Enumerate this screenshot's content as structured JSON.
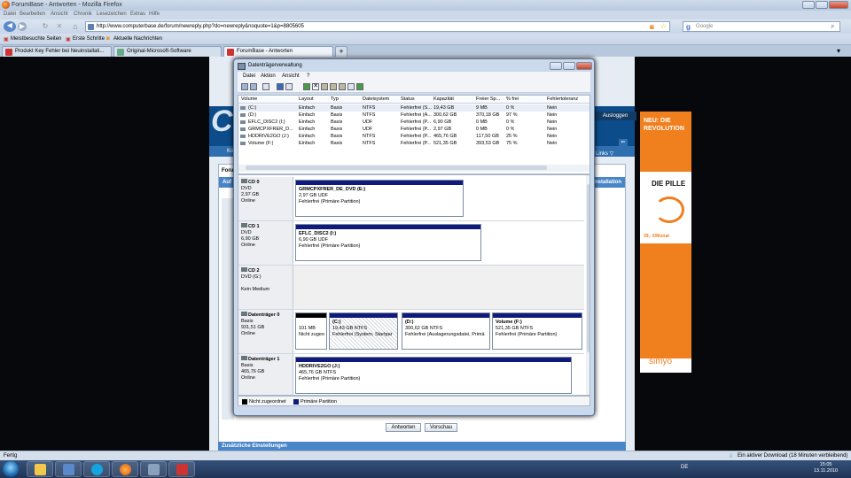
{
  "browser": {
    "title": "ForumBase - Antworten - Mozilla Firefox",
    "menu": [
      "Datei",
      "Bearbeiten",
      "Ansicht",
      "Chronik",
      "Lesezeichen",
      "Extras",
      "Hilfe"
    ],
    "url": "http://www.computerbase.de/forum/newreply.php?do=newreply&noquote=1&p=8805605",
    "search_placeholder": "Google",
    "bookmarks": [
      "Meistbesuchte Seiten",
      "Erste Schritte",
      "Aktuelle Nachrichten"
    ],
    "tabs": [
      "Produkt Key Fehler bei Neuinstallati...",
      "Original-Microsoft-Software",
      "ForumBase - Antworten"
    ],
    "status_left": "Fertig",
    "status_right": "Ein aktiver Download (18 Minuten verbleibend)"
  },
  "site": {
    "logo": "C",
    "ausloggen": "Ausloggen",
    "links": "Links ▽",
    "forum_label": "Foru",
    "panel_title": "Auf",
    "installation": "Installation",
    "ko": "Ko",
    "reply_button": "Antworten",
    "preview_button": "Vorschau",
    "extra_settings": "Zusätzliche Einstellungen"
  },
  "ad": {
    "top": "NEU: DIE REVOLUTION",
    "pille": "DIE PILLE",
    "price": "39,- €/Monat",
    "brand": "simyo"
  },
  "mmc": {
    "title": "Datenträgerverwaltung",
    "menu": [
      "Datei",
      "Aktion",
      "Ansicht",
      "?"
    ],
    "columns": [
      "Volume",
      "Layout",
      "Typ",
      "Dateisystem",
      "Status",
      "Kapazität",
      "Freier Sp...",
      "% frei",
      "Fehlertoleranz"
    ],
    "volumes": [
      [
        "(C:)",
        "Einfach",
        "Basis",
        "NTFS",
        "Fehlerfrei (S...",
        "19,43 GB",
        "9 MB",
        "0 %",
        "Nein"
      ],
      [
        "(D:)",
        "Einfach",
        "Basis",
        "NTFS",
        "Fehlerfrei (A...",
        "300,62 GB",
        "370,18 GB",
        "97 %",
        "Nein"
      ],
      [
        "EFLC_DISC2 (I:)",
        "Einfach",
        "Basis",
        "UDF",
        "Fehlerfrei (P...",
        "6,90 GB",
        "0 MB",
        "0 %",
        "Nein"
      ],
      [
        "GRMCPXFRER_D...",
        "Einfach",
        "Basis",
        "UDF",
        "Fehlerfrei (P...",
        "2,97 GB",
        "0 MB",
        "0 %",
        "Nein"
      ],
      [
        "HDDRIVE2GO (J:)",
        "Einfach",
        "Basis",
        "NTFS",
        "Fehlerfrei (P...",
        "465,76 GB",
        "117,50 GB",
        "25 %",
        "Nein"
      ],
      [
        "Volume (F:)",
        "Einfach",
        "Basis",
        "NTFS",
        "Fehlerfrei (P...",
        "521,35 GB",
        "393,53 GB",
        "75 %",
        "Nein"
      ]
    ],
    "disks": [
      {
        "name": "CD 0",
        "lines": [
          "DVD",
          "2,97 GB",
          "Online"
        ],
        "parts": [
          {
            "title": "GRMCPXFRER_DE_DVD  (E:)",
            "l1": "2,97 GB UDF",
            "l2": "Fehlerfrei (Primäre Partition)"
          }
        ]
      },
      {
        "name": "CD 1",
        "lines": [
          "DVD",
          "6,90 GB",
          "Online"
        ],
        "parts": [
          {
            "title": "EFLC_DISC2  (I:)",
            "l1": "6,90 GB UDF",
            "l2": "Fehlerfrei (Primäre Partition)"
          }
        ]
      },
      {
        "name": "CD 2",
        "lines": [
          "DVD (G:)",
          "",
          "Kein Medium"
        ],
        "parts": []
      },
      {
        "name": "Datenträger 0",
        "lines": [
          "Basis",
          "931,51 GB",
          "Online"
        ],
        "parts": [
          {
            "title": "",
            "l1": "101 MB",
            "l2": "Nicht zugeo"
          },
          {
            "title": "(C:)",
            "l1": "19,43 GB NTFS",
            "l2": "Fehlerfrei (System, Startpar"
          },
          {
            "title": "(D:)",
            "l1": "300,62 GB NTFS",
            "l2": "Fehlerfrei (Auslagerungsdatei, Primä"
          },
          {
            "title": "Volume  (F:)",
            "l1": "521,35 GB NTFS",
            "l2": "Fehlerfrei (Primäre Partition)"
          }
        ]
      },
      {
        "name": "Datenträger 1",
        "lines": [
          "Basis",
          "465,76 GB",
          "Online"
        ],
        "parts": [
          {
            "title": "HDDRIVE2GO  (J:)",
            "l1": "465,76 GB NTFS",
            "l2": "Fehlerfrei (Primäre Partition)"
          }
        ]
      }
    ],
    "legend": [
      "Nicht zugeordnet",
      "Primäre Partition"
    ],
    "colors": {
      "unallocated": "#000000",
      "primary": "#101a7a"
    }
  },
  "taskbar": {
    "lang": "DE",
    "time": "15:05",
    "date": "13.11.2010",
    "icons": [
      "explorer-icon",
      "folder-icon",
      "skype-icon",
      "firefox-icon",
      "mmc-icon",
      "app-icon"
    ]
  }
}
